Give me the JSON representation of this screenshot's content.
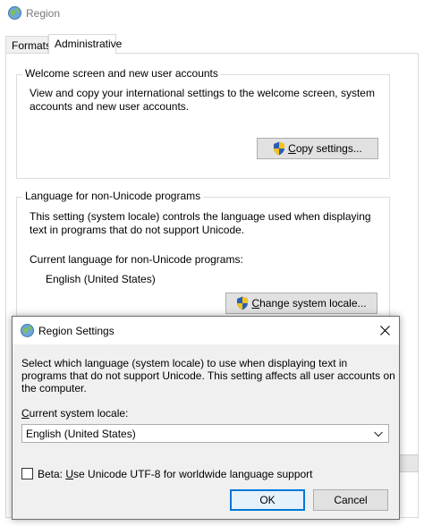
{
  "region_window": {
    "title": "Region",
    "tabs": [
      {
        "label": "Formats"
      },
      {
        "label": "Administrative"
      }
    ],
    "welcome_group": {
      "title": "Welcome screen and new user accounts",
      "description": "View and copy your international settings to the welcome screen, system accounts and new user accounts.",
      "copy_button": {
        "prefix": "",
        "accel": "C",
        "rest": "opy settings..."
      }
    },
    "nonunicode_group": {
      "title": "Language for non-Unicode programs",
      "description": "This setting (system locale) controls the language used when displaying text in programs that do not support Unicode.",
      "current_label": "Current language for non-Unicode programs:",
      "current_value": "English (United States)",
      "change_button": {
        "prefix": "",
        "accel": "C",
        "rest": "hange system locale..."
      }
    }
  },
  "settings_dialog": {
    "title": "Region Settings",
    "description": "Select which language (system locale) to use when displaying text in programs that do not support Unicode. This setting affects all user accounts on the computer.",
    "locale_label": {
      "accel": "C",
      "rest": "urrent system locale:"
    },
    "locale_selected": "English (United States)",
    "beta_checkbox": {
      "prefix": "Beta: ",
      "accel": "U",
      "rest": "se Unicode UTF-8 for worldwide language support",
      "checked": false
    },
    "ok_label": "OK",
    "cancel_label": "Cancel"
  },
  "icons": {
    "region_app_icon": "globe-icon",
    "shield_icon": "uac-shield-icon",
    "close_icon": "close-icon",
    "chevron_icon": "chevron-down-icon"
  },
  "colors": {
    "accent": "#0078d7",
    "button_face": "#e1e1e1",
    "dialog_face": "#f0f0f0",
    "border": "#adadad"
  }
}
